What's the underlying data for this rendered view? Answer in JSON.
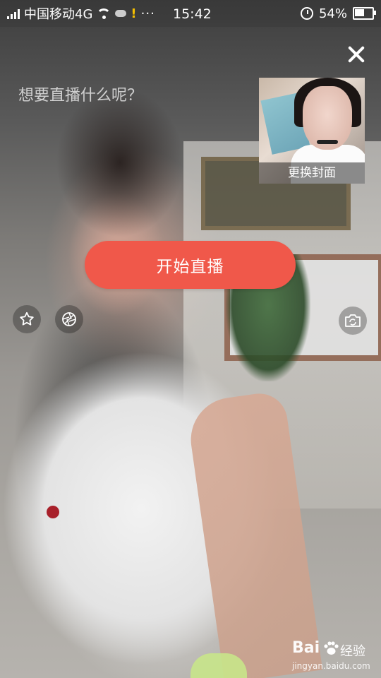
{
  "status_bar": {
    "carrier": "中国移动4G",
    "time": "15:42",
    "battery_percent": "54%",
    "battery_level": 0.54,
    "icons": [
      "signal-icon",
      "wifi-icon",
      "weather-icon",
      "warning-icon",
      "more-dots-icon",
      "alarm-icon",
      "battery-icon"
    ],
    "more_dots": "···",
    "warning_mark": "!"
  },
  "header": {
    "close_icon": "close-icon"
  },
  "live_setup": {
    "title_placeholder": "想要直播什么呢？",
    "title_value": "",
    "cover_label": "更换封面",
    "start_button_label": "开始直播",
    "accent_color": "#f0584a"
  },
  "tools": {
    "left": [
      {
        "name": "star-icon"
      },
      {
        "name": "beauty-filter-icon"
      }
    ],
    "right": [
      {
        "name": "switch-camera-icon"
      }
    ]
  },
  "watermark": {
    "brand": "Bai",
    "brand_suffix": "经验",
    "url": "jingyan.baidu.com"
  }
}
